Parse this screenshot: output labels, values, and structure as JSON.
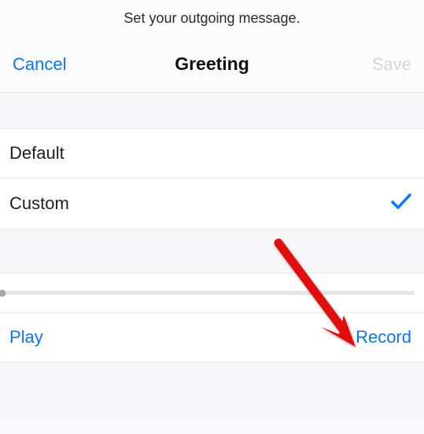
{
  "instruction": "Set your outgoing message.",
  "navbar": {
    "cancel": "Cancel",
    "title": "Greeting",
    "save": "Save"
  },
  "options": {
    "default": "Default",
    "custom": "Custom",
    "selected": "custom"
  },
  "controls": {
    "play": "Play",
    "record": "Record"
  },
  "annotation": {
    "arrow_target": "record-button",
    "arrow_color": "#e20a0a"
  }
}
